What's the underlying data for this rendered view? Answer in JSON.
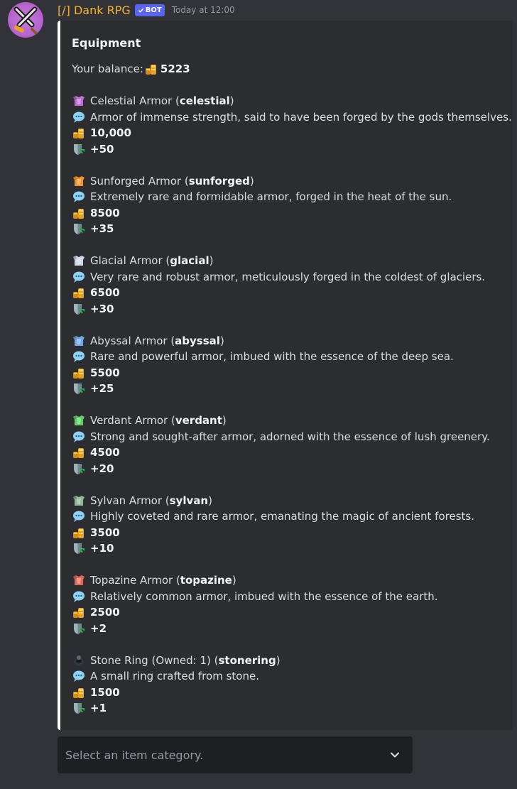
{
  "message": {
    "username": "[/] Dank RPG",
    "bot_tag": "BOT",
    "timestamp": "Today at 12:00"
  },
  "embed": {
    "title": "Equipment",
    "balance_label": "Your balance: ",
    "balance_value": "5223",
    "accent_color": "#ffffff",
    "items": [
      {
        "name": "Celestial Armor",
        "id": "celestial",
        "description": "Armor of immense strength, said to have been forged by the gods themselves.",
        "price": "10,000",
        "defense": "+50",
        "icon": "celestial-armor-icon",
        "icon_color": "#c16bd6"
      },
      {
        "name": "Sunforged Armor",
        "id": "sunforged",
        "description": "Extremely rare and formidable armor, forged in the heat of the sun.",
        "price": "8500",
        "defense": "+35",
        "icon": "sunforged-armor-icon",
        "icon_color": "#f0932b"
      },
      {
        "name": "Glacial Armor",
        "id": "glacial",
        "description": "Very rare and robust armor, meticulously forged in the coldest of glaciers.",
        "price": "6500",
        "defense": "+30",
        "icon": "glacial-armor-icon",
        "icon_color": "#cfd6e6"
      },
      {
        "name": "Abyssal Armor",
        "id": "abyssal",
        "description": "Rare and powerful armor, imbued with the essence of the deep sea.",
        "price": "5500",
        "defense": "+25",
        "icon": "abyssal-armor-icon",
        "icon_color": "#6fa8e8"
      },
      {
        "name": "Verdant Armor",
        "id": "verdant",
        "description": "Strong and sought-after armor, adorned with the essence of lush greenery.",
        "price": "4500",
        "defense": "+20",
        "icon": "verdant-armor-icon",
        "icon_color": "#5fcf6a"
      },
      {
        "name": "Sylvan Armor",
        "id": "sylvan",
        "description": "Highly coveted and rare armor, emanating the magic of ancient forests.",
        "price": "3500",
        "defense": "+10",
        "icon": "sylvan-armor-icon",
        "icon_color": "#8fb59a"
      },
      {
        "name": "Topazine Armor",
        "id": "topazine",
        "description": "Relatively common armor, imbued with the essence of the earth.",
        "price": "2500",
        "defense": "+2",
        "icon": "topazine-armor-icon",
        "icon_color": "#e06a5a"
      },
      {
        "name": "Stone Ring (Owned: 1)",
        "id": "stonering",
        "description": "A small ring crafted from stone.",
        "price": "1500",
        "defense": "+1",
        "icon": "stone-ring-icon",
        "icon_color": "#2f3a44"
      }
    ]
  },
  "select": {
    "placeholder": "Select an item category."
  }
}
